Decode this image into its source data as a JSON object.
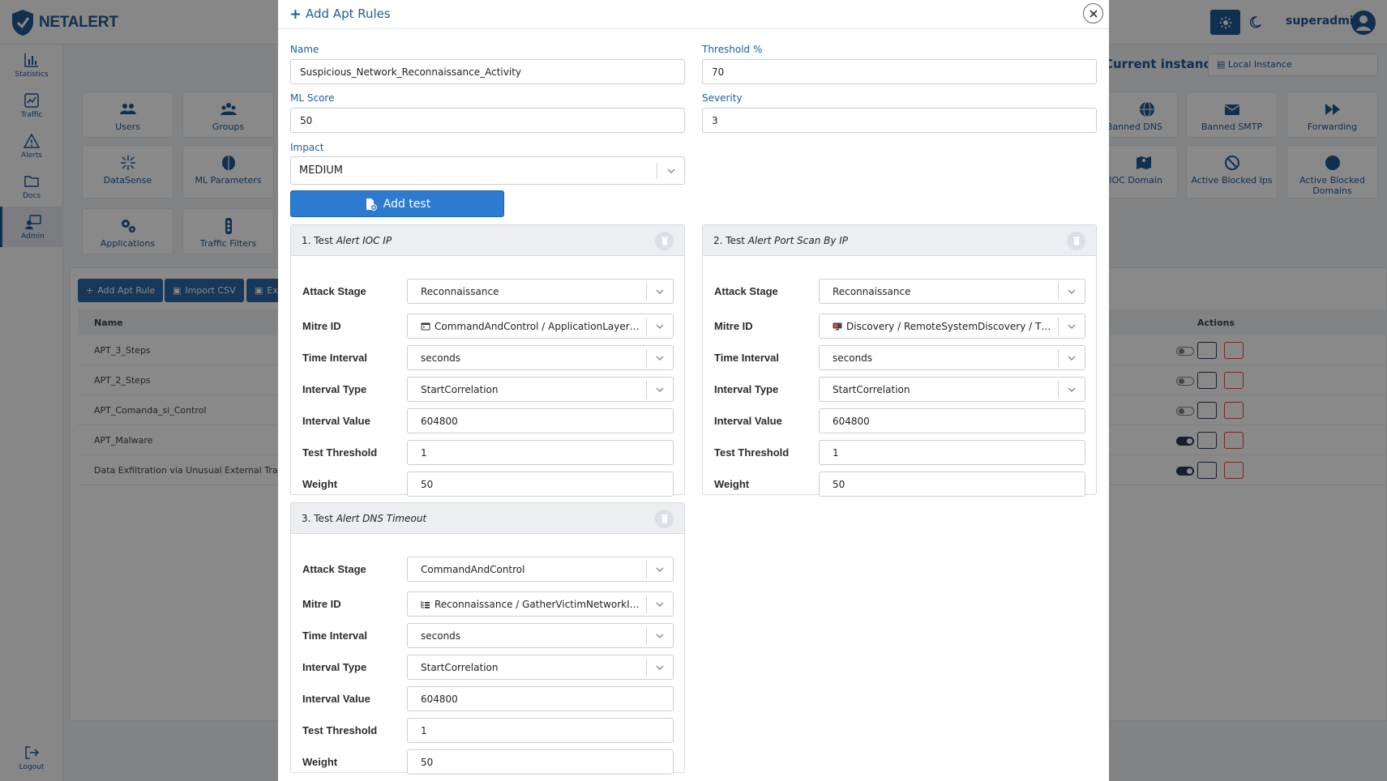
{
  "app": {
    "logo_text": "NETALERT",
    "user_name": "superadmin",
    "instance_label": "Current instance:",
    "instance_value": "Local Instance"
  },
  "sidebar": {
    "items": [
      {
        "label": "Statistics",
        "icon": "chart-icon"
      },
      {
        "label": "Traffic",
        "icon": "traffic-chart-icon"
      },
      {
        "label": "Alerts",
        "icon": "warning-icon"
      },
      {
        "label": "Docs",
        "icon": "folder-icon"
      },
      {
        "label": "Admin",
        "icon": "admin-icon"
      }
    ],
    "logout_label": "Logout"
  },
  "tiles": [
    {
      "label": "Users"
    },
    {
      "label": "Groups"
    },
    {
      "label": "DataSense"
    },
    {
      "label": "ML Parameters"
    },
    {
      "label": "Applications"
    },
    {
      "label": "Traffic Filters"
    },
    {
      "label": "Banned DNS"
    },
    {
      "label": "Banned SMTP"
    },
    {
      "label": "Forwarding"
    },
    {
      "label": "IOC Domain"
    },
    {
      "label": "Active Blocked Ips"
    },
    {
      "label": "Active Blocked Domains"
    }
  ],
  "table": {
    "add_button": "Add Apt Rule",
    "import_button": "Import CSV",
    "export_button": "Ex",
    "col_name": "Name",
    "col_actions": "Actions",
    "rows": [
      {
        "name": "APT_3_Steps",
        "enabled": false
      },
      {
        "name": "APT_2_Steps",
        "enabled": false
      },
      {
        "name": "APT_Comanda_si_Control",
        "enabled": false
      },
      {
        "name": "APT_Malware",
        "enabled": true
      },
      {
        "name": "Data Exfiltration via Unusual External Transfer",
        "enabled": true
      }
    ]
  },
  "modal": {
    "title": "Add Apt Rules",
    "name_label": "Name",
    "name_value": "Suspicious_Network_Reconnaissance_Activity",
    "threshold_label": "Threshold %",
    "threshold_value": "70",
    "ml_label": "ML Score",
    "ml_value": "50",
    "severity_label": "Severity",
    "severity_value": "3",
    "impact_label": "Impact",
    "impact_value": "MEDIUM",
    "add_test_label": "Add test",
    "field_labels": {
      "attack_stage": "Attack Stage",
      "mitre_id": "Mitre ID",
      "time_interval": "Time Interval",
      "interval_type": "Interval Type",
      "interval_value": "Interval Value",
      "test_threshold": "Test Threshold",
      "weight": "Weight"
    },
    "tests": [
      {
        "prefix": "1. Test ",
        "name": "Alert IOC IP",
        "attack_stage": "Reconnaissance",
        "mitre_id": "CommandAndControl / ApplicationLayerPr...",
        "mitre_icon": "terminal-icon",
        "time_interval": "seconds",
        "interval_type": "StartCorrelation",
        "interval_value": "604800",
        "test_threshold": "1",
        "weight": "50"
      },
      {
        "prefix": "2. Test ",
        "name": "Alert Port Scan By IP",
        "attack_stage": "Reconnaissance",
        "mitre_id": "Discovery / RemoteSystemDiscovery / T10...",
        "mitre_icon": "monitor-icon",
        "time_interval": "seconds",
        "interval_type": "StartCorrelation",
        "interval_value": "604800",
        "test_threshold": "1",
        "weight": "50"
      },
      {
        "prefix": "3. Test ",
        "name": "Alert DNS Timeout",
        "attack_stage": "CommandAndControl",
        "mitre_id": "Reconnaissance / GatherVictimNetworkInf...",
        "mitre_icon": "tree-icon",
        "time_interval": "seconds",
        "interval_type": "StartCorrelation",
        "interval_value": "604800",
        "test_threshold": "1",
        "weight": "50"
      }
    ]
  },
  "colors": {
    "brand": "#0e4a8a",
    "accent": "#2c7bd0",
    "danger": "#d63a3a"
  }
}
